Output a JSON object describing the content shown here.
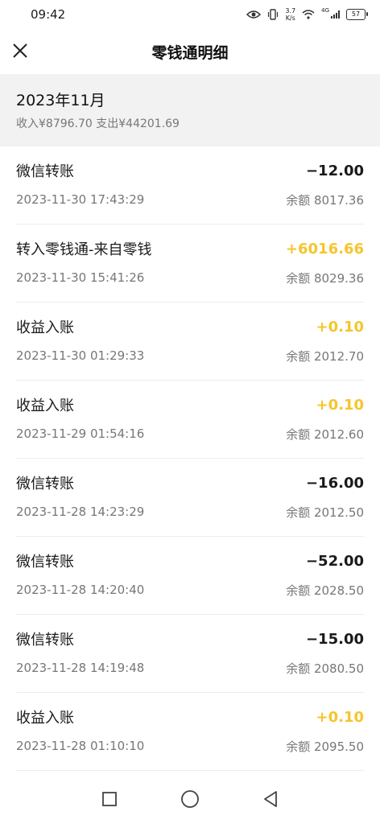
{
  "status_bar": {
    "time": "09:42",
    "speed_value": "3.7",
    "speed_unit": "K/s",
    "network": "4G",
    "battery": "57"
  },
  "header": {
    "title": "零钱通明细"
  },
  "month": {
    "title": "2023年11月",
    "summary": "收入¥8796.70 支出¥44201.69"
  },
  "transactions": [
    {
      "title": "微信转账",
      "amount": "−12.00",
      "time": "2023-11-30 17:43:29",
      "balance": "余额 8017.36"
    },
    {
      "title": "转入零钱通-来自零钱",
      "amount": "+6016.66",
      "time": "2023-11-30 15:41:26",
      "balance": "余额 8029.36"
    },
    {
      "title": "收益入账",
      "amount": "+0.10",
      "time": "2023-11-30 01:29:33",
      "balance": "余额 2012.70"
    },
    {
      "title": "收益入账",
      "amount": "+0.10",
      "time": "2023-11-29 01:54:16",
      "balance": "余额 2012.60"
    },
    {
      "title": "微信转账",
      "amount": "−16.00",
      "time": "2023-11-28 14:23:29",
      "balance": "余额 2012.50"
    },
    {
      "title": "微信转账",
      "amount": "−52.00",
      "time": "2023-11-28 14:20:40",
      "balance": "余额 2028.50"
    },
    {
      "title": "微信转账",
      "amount": "−15.00",
      "time": "2023-11-28 14:19:48",
      "balance": "余额 2080.50"
    },
    {
      "title": "收益入账",
      "amount": "+0.10",
      "time": "2023-11-28 01:10:10",
      "balance": "余额 2095.50"
    }
  ],
  "colors": {
    "income": "#f5c52c",
    "expense": "#1a1a1a",
    "header_bg": "#f2f2f2"
  }
}
